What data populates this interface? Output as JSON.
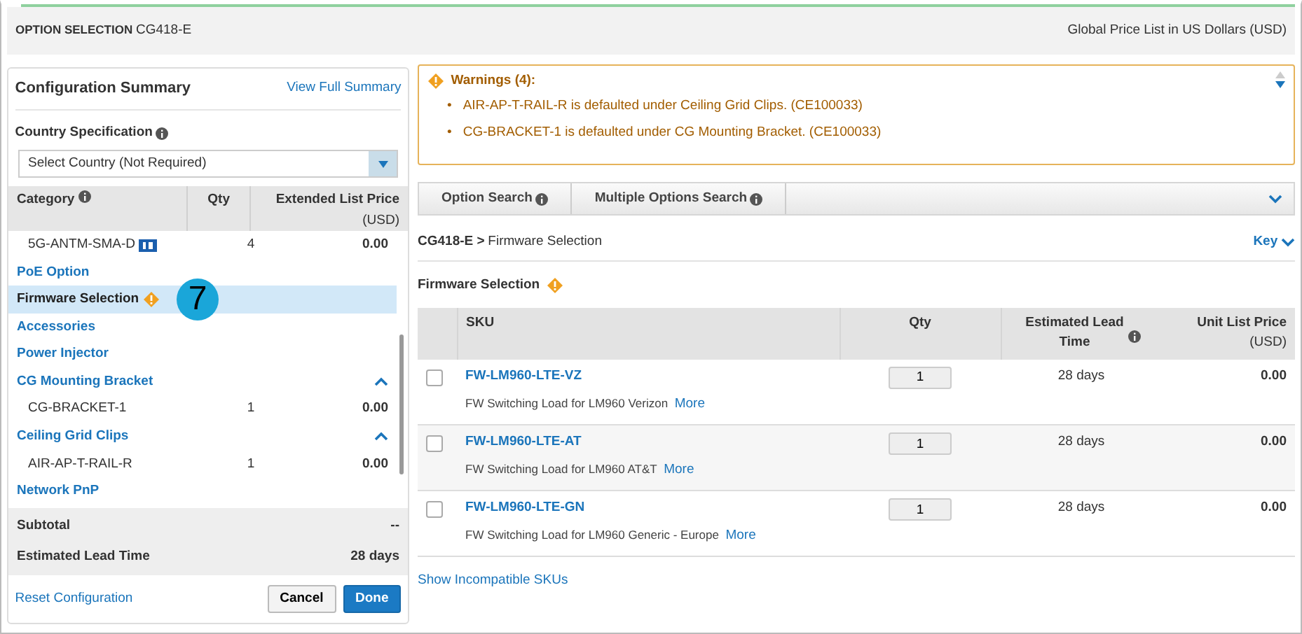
{
  "header": {
    "title": "OPTION SELECTION",
    "product": "CG418-E",
    "price_list": "Global Price List in US Dollars (USD)"
  },
  "summary": {
    "title": "Configuration Summary",
    "view_link": "View Full Summary",
    "country_label": "Country Specification",
    "country_value": "Select Country (Not Required)",
    "columns": [
      "Category",
      "Qty",
      "**Extended List Price** (USD)"
    ],
    "items": [
      {
        "kind": "item",
        "name": "5G-ANTM-SMA-D",
        "qty": "4",
        "price": "0.00",
        "tagged": true
      },
      {
        "kind": "category",
        "name": "PoE Option",
        "selected": false,
        "warning": false,
        "expanded": false
      },
      {
        "kind": "category",
        "name": "Firmware Selection",
        "selected": true,
        "warning": true,
        "expanded": false,
        "callout": "7"
      },
      {
        "kind": "category",
        "name": "Accessories",
        "selected": false,
        "warning": false,
        "expanded": false
      },
      {
        "kind": "category",
        "name": "Power Injector",
        "selected": false,
        "warning": false,
        "expanded": false
      },
      {
        "kind": "category",
        "name": "CG Mounting Bracket",
        "selected": false,
        "warning": false,
        "expanded": true
      },
      {
        "kind": "item",
        "name": "CG-BRACKET-1",
        "qty": "1",
        "price": "0.00"
      },
      {
        "kind": "category",
        "name": "Ceiling Grid Clips",
        "selected": false,
        "warning": false,
        "expanded": true
      },
      {
        "kind": "item",
        "name": "AIR-AP-T-RAIL-R",
        "qty": "1",
        "price": "0.00"
      },
      {
        "kind": "category",
        "name": "Network PnP",
        "selected": false,
        "warning": false,
        "expanded": false
      }
    ],
    "totals": [
      {
        "label": "Subtotal",
        "value": "--"
      },
      {
        "label": "Estimated Lead Time",
        "value": "28 days"
      }
    ],
    "reset": "Reset Configuration",
    "cancel": "Cancel",
    "done": "Done"
  },
  "warnings": {
    "title": "Warnings (4):",
    "items": [
      {
        "bullet": "•",
        "text": "AIR-AP-T-RAIL-R is defaulted under Ceiling Grid Clips. (CE100033)"
      },
      {
        "bullet": "•",
        "text": "CG-BRACKET-1 is defaulted under CG Mounting Bracket. (CE100033)"
      }
    ]
  },
  "tabs": [
    {
      "label": "Option Search"
    },
    {
      "label": "Multiple Options Search"
    }
  ],
  "breadcrumb": {
    "parent": "CG418-E >",
    "current": "Firmware Selection",
    "key": "Key"
  },
  "section": {
    "title": "Firmware Selection",
    "warning": true
  },
  "table": {
    "columns": [
      "SKU",
      "Qty",
      "Estimated Lead Time",
      "**Unit List Price** (USD)"
    ],
    "rows": [
      {
        "checked": false,
        "sku": "FW-LM960-LTE-VZ",
        "description": "FW Switching Load for LM960 Verizon",
        "more": "More",
        "qty": "1",
        "lead": "28 days",
        "price": "0.00"
      },
      {
        "checked": false,
        "sku": "FW-LM960-LTE-AT",
        "description": "FW Switching Load for LM960 AT&T",
        "more": "More",
        "qty": "1",
        "lead": "28 days",
        "price": "0.00"
      },
      {
        "checked": false,
        "sku": "FW-LM960-LTE-GN",
        "description": "FW Switching Load for LM960 Generic - Europe",
        "more": "More",
        "qty": "1",
        "lead": "28 days",
        "price": "0.00"
      }
    ]
  },
  "show_incompatible": "Show Incompatible SKUs"
}
